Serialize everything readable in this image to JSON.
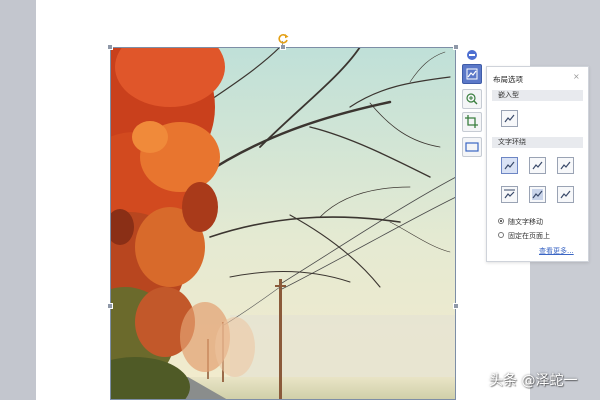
{
  "document": {
    "image": {
      "description_icon": "photo-autumn-road",
      "colors": {
        "sky_top": "#bfe0d8",
        "sky_bottom": "#f1e9c8",
        "foliage": "#d9461d"
      }
    }
  },
  "quick_toolbar": {
    "items": [
      {
        "name": "layout-options",
        "icon": "layout-wrap-icon",
        "active": true
      },
      {
        "name": "zoom",
        "icon": "zoom-icon",
        "active": false
      },
      {
        "name": "crop",
        "icon": "crop-icon",
        "active": false
      },
      {
        "name": "border",
        "icon": "frame-icon",
        "active": false
      }
    ]
  },
  "layout_panel": {
    "title": "布局选项",
    "close": "×",
    "inline_section": "嵌入型",
    "wrap_section": "文字环绕",
    "radio_options": [
      {
        "label": "随文字移动",
        "checked": true
      },
      {
        "label": "固定在页面上",
        "checked": false
      }
    ],
    "see_more": "查看更多..."
  },
  "watermark": "头条 @泽蛇一"
}
